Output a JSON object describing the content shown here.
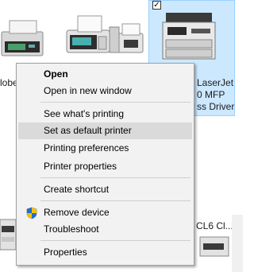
{
  "devices": {
    "item1": {
      "label": "lobe"
    },
    "item4": {
      "label_lines": [
        "LaserJet",
        "0 MFP",
        "ss Driver"
      ],
      "checked": "✓"
    },
    "bottom_item": {
      "label": "CL6 Cl..."
    }
  },
  "context_menu": {
    "items": [
      {
        "label": "Open",
        "bold": true
      },
      {
        "label": "Open in new window"
      },
      {
        "label": "See what's printing"
      },
      {
        "label": "Set as default printer",
        "highlighted": true
      },
      {
        "label": "Printing preferences"
      },
      {
        "label": "Printer properties"
      },
      {
        "label": "Create shortcut"
      },
      {
        "label": "Remove device",
        "icon": "uac-shield-icon"
      },
      {
        "label": "Troubleshoot"
      },
      {
        "label": "Properties"
      }
    ]
  },
  "colors": {
    "menu_bg": "#f2f2f2",
    "highlight": "#dadada",
    "selected_tile": "#cce8ff"
  }
}
